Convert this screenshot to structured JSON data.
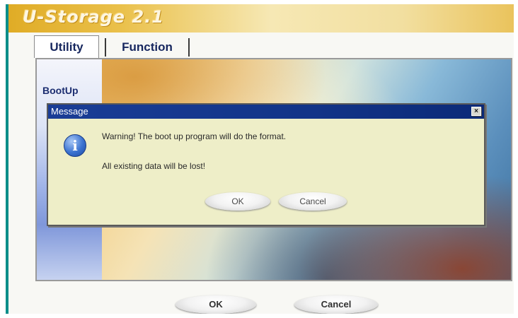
{
  "app": {
    "title": "U-Storage 2.1"
  },
  "tabs": [
    {
      "label": "Utility",
      "active": true
    },
    {
      "label": "Function",
      "active": false
    }
  ],
  "sidebar": {
    "items": [
      {
        "label": "BootUp"
      }
    ]
  },
  "dialog": {
    "title": "Message",
    "close_glyph": "×",
    "icon": "info-icon",
    "icon_glyph": "i",
    "line1": "Warning! The boot up program will do the format.",
    "line2": "All existing data will be lost!",
    "ok_label": "OK",
    "cancel_label": "Cancel"
  },
  "footer": {
    "ok_label": "OK",
    "cancel_label": "Cancel"
  },
  "colors": {
    "title_bar_gold": "#e0ac26",
    "dialog_titlebar_blue": "#123488",
    "dialog_body": "#eeeec8",
    "tab_text": "#16265e",
    "window_border": "#0b8e8a"
  }
}
